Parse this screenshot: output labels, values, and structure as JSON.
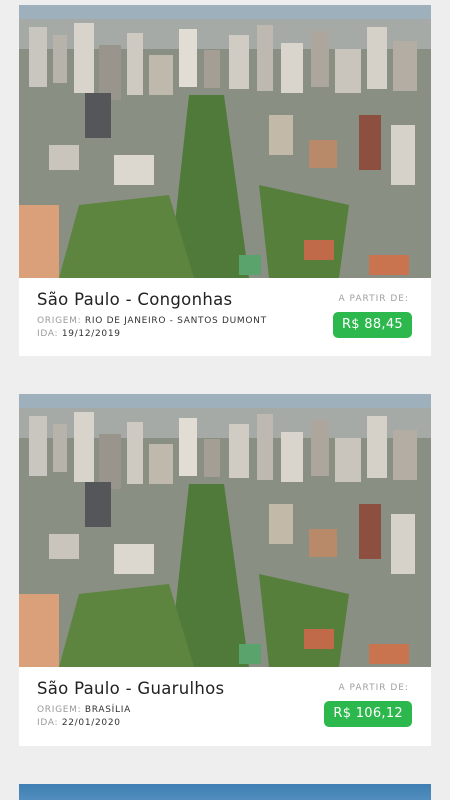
{
  "flights": [
    {
      "destination": "São Paulo - Congonhas",
      "origin_label": "ORIGEM:",
      "origin_value": "RIO DE JANEIRO - SANTOS DUMONT",
      "date_label": "IDA:",
      "date_value": "19/12/2019",
      "price_label": "A PARTIR DE:",
      "price": "R$ 88,45"
    },
    {
      "destination": "São Paulo - Guarulhos",
      "origin_label": "ORIGEM:",
      "origin_value": "BRASÍLIA",
      "date_label": "IDA:",
      "date_value": "22/01/2020",
      "price_label": "A PARTIR DE:",
      "price": "R$ 106,12"
    }
  ],
  "colors": {
    "price_badge": "#2db84d",
    "background": "#eeeeee",
    "card": "#ffffff"
  }
}
